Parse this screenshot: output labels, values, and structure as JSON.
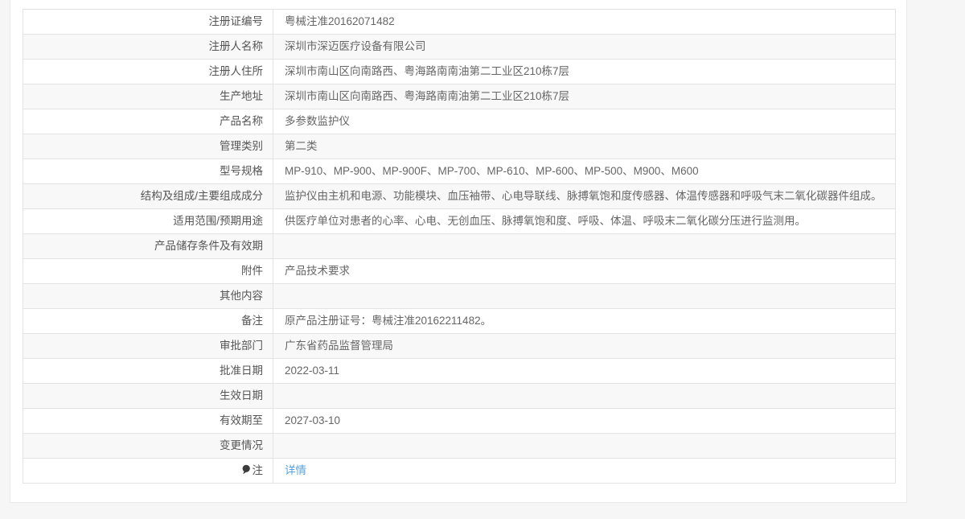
{
  "page": {
    "background": "#f6f6f6",
    "panel_background": "#ffffff",
    "panel_border": "#e9e9e9",
    "table_outer_border": "#d9d9d9",
    "table_inner_border": "#e3e3e3",
    "row_alt_background": "#f8f8f8",
    "label_color": "#555555",
    "value_color": "#666666",
    "link_color": "#56a0dc"
  },
  "table": {
    "rows": [
      {
        "label": "注册证编号",
        "value": "粤械注准20162071482",
        "type": "text"
      },
      {
        "label": "注册人名称",
        "value": "深圳市深迈医疗设备有限公司",
        "type": "text"
      },
      {
        "label": "注册人住所",
        "value": "深圳市南山区向南路西、粤海路南南油第二工业区210栋7层",
        "type": "text"
      },
      {
        "label": "生产地址",
        "value": "深圳市南山区向南路西、粤海路南南油第二工业区210栋7层",
        "type": "text"
      },
      {
        "label": "产品名称",
        "value": "多参数监护仪",
        "type": "text"
      },
      {
        "label": "管理类别",
        "value": "第二类",
        "type": "text"
      },
      {
        "label": "型号规格",
        "value": "MP-910、MP-900、MP-900F、MP-700、MP-610、MP-600、MP-500、M900、M600",
        "type": "text"
      },
      {
        "label": "结构及组成/主要组成成分",
        "value": "监护仪由主机和电源、功能模块、血压袖带、心电导联线、脉搏氧饱和度传感器、体温传感器和呼吸气末二氧化碳器件组成。",
        "type": "text"
      },
      {
        "label": "适用范围/预期用途",
        "value": "供医疗单位对患者的心率、心电、无创血压、脉搏氧饱和度、呼吸、体温、呼吸末二氧化碳分压进行监测用。",
        "type": "text"
      },
      {
        "label": "产品储存条件及有效期",
        "value": "",
        "type": "text"
      },
      {
        "label": "附件",
        "value": "产品技术要求",
        "type": "text"
      },
      {
        "label": "其他内容",
        "value": "",
        "type": "text"
      },
      {
        "label": "备注",
        "value": "原产品注册证号：粤械注准20162211482。",
        "type": "text"
      },
      {
        "label": "审批部门",
        "value": "广东省药品监督管理局",
        "type": "text"
      },
      {
        "label": "批准日期",
        "value": "2022-03-11",
        "type": "text"
      },
      {
        "label": "生效日期",
        "value": "",
        "type": "text"
      },
      {
        "label": "有效期至",
        "value": "2027-03-10",
        "type": "text"
      },
      {
        "label": "变更情况",
        "value": "",
        "type": "text"
      },
      {
        "label": "注",
        "value": "详情",
        "type": "link",
        "icon": "note-balloon-icon"
      }
    ]
  }
}
